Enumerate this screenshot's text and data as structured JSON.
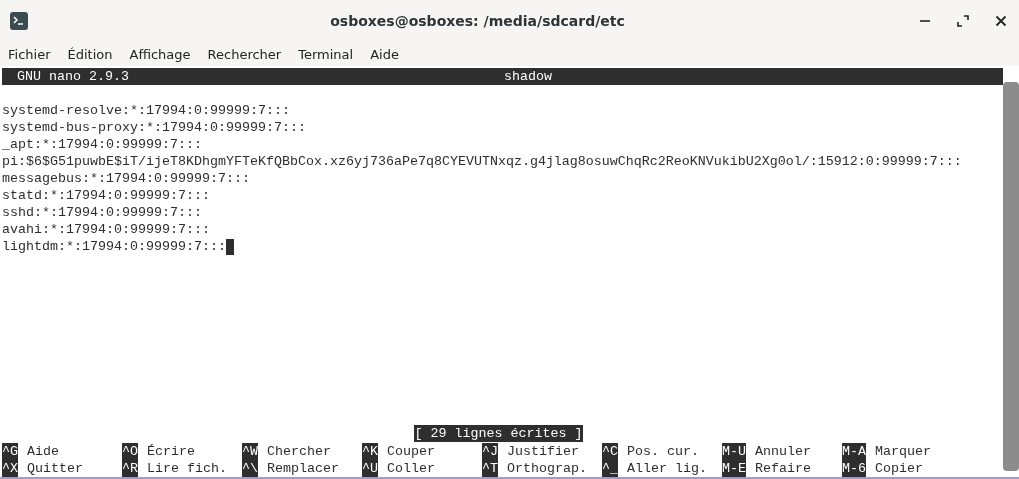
{
  "window": {
    "title": "osboxes@osboxes: /media/sdcard/etc"
  },
  "menu": [
    "Fichier",
    "Édition",
    "Affichage",
    "Rechercher",
    "Terminal",
    "Aide"
  ],
  "nano_header": {
    "version": "GNU nano 2.9.3",
    "filename": "shadow"
  },
  "lines": [
    "systemd-resolve:*:17994:0:99999:7:::",
    "systemd-bus-proxy:*:17994:0:99999:7:::",
    "_apt:*:17994:0:99999:7:::",
    "pi:$6$G51puwbE$iT/ijeT8KDhgmYFTeKfQBbCox.xz6yj736aPe7q8CYEVUTNxqz.g4jlag8osuwChqRc2ReoKNVukibU2Xg0ol/:15912:0:99999:7:::",
    "messagebus:*:17994:0:99999:7:::",
    "statd:*:17994:0:99999:7:::",
    "sshd:*:17994:0:99999:7:::",
    "avahi:*:17994:0:99999:7:::",
    "lightdm:*:17994:0:99999:7:::"
  ],
  "status_message": "[ 29 lignes écrites ]",
  "shortcut_rows": [
    [
      {
        "key": "^G",
        "label": "Aide"
      },
      {
        "key": "^O",
        "label": "Écrire"
      },
      {
        "key": "^W",
        "label": "Chercher"
      },
      {
        "key": "^K",
        "label": "Couper"
      },
      {
        "key": "^J",
        "label": "Justifier"
      },
      {
        "key": "^C",
        "label": "Pos. cur."
      },
      {
        "key": "M-U",
        "label": "Annuler"
      },
      {
        "key": "M-A",
        "label": "Marquer"
      }
    ],
    [
      {
        "key": "^X",
        "label": "Quitter"
      },
      {
        "key": "^R",
        "label": "Lire fich."
      },
      {
        "key": "^\\",
        "label": "Remplacer"
      },
      {
        "key": "^U",
        "label": "Coller"
      },
      {
        "key": "^T",
        "label": "Orthograp."
      },
      {
        "key": "^_",
        "label": "Aller lig."
      },
      {
        "key": "M-E",
        "label": "Refaire"
      },
      {
        "key": "M-6",
        "label": "Copier"
      }
    ]
  ]
}
